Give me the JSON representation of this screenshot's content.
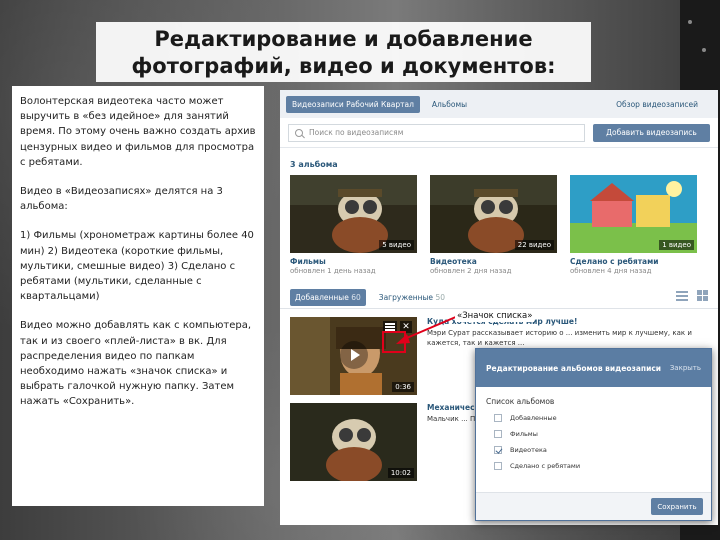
{
  "slide": {
    "title_line1": "Редактирование и добавление",
    "title_line2": "фотографий, видео и документов:",
    "paragraphs": [
      "Волонтерская видеотека часто может выручить в «без идейное» для занятий время. По этому очень важно создать архив цензурных видео и фильмов для просмотра с ребятами.",
      "Видео в «Видеозаписях» делятся на 3 альбома:",
      "1) Фильмы (хронометраж картины более 40 мин) 2) Видеотека (короткие фильмы, мультики, смешные видео) 3) Сделано с ребятами (мультики, сделанные с квартальцами)",
      "Видео можно добавлять как с компьютера, так и из своего «плей-листа» в вк. Для распределения видео по папкам необходимо нажать «значок списка» и выбрать галочкой нужную папку. Затем нажать «Сохранить»."
    ],
    "callout_label": "«Значок списка»"
  },
  "vk": {
    "tabs": [
      {
        "label": "Видеозаписи Рабочий Квартал"
      },
      {
        "label": "Альбомы"
      },
      {
        "label": "Обзор видеозаписей"
      }
    ],
    "search_placeholder": "Поиск по видеозаписям",
    "add_button": "Добавить видеозапись",
    "albums_heading": "3 альбома",
    "albums": [
      {
        "name": "Фильмы",
        "date": "обновлен 1 день назад",
        "count": "5 видео"
      },
      {
        "name": "Видеотека",
        "date": "обновлен 2 дня назад",
        "count": "22 видео"
      },
      {
        "name": "Сделано с ребятами",
        "date": "обновлен 4 дня назад",
        "count": "1 видео"
      }
    ],
    "video_tabs": [
      {
        "label": "Добавленные",
        "count": "60"
      },
      {
        "label": "Загруженные",
        "count": "50"
      }
    ],
    "videos": [
      {
        "title": "Куда хочется сделать мир лучше!",
        "desc": "Мэри Сурат рассказывает историю о ... изменить мир к лучшему, как и кажется, так и кажется ...",
        "duration": "0:36"
      },
      {
        "title": "Механическое сердце",
        "desc": "Мальчик ... Премьера ...",
        "duration": "10:02"
      }
    ]
  },
  "dialog": {
    "title": "Редактирование альбомов видеозаписи",
    "close_label": "Закрыть",
    "subtitle": "Список альбомов",
    "options": [
      {
        "label": "Добавленные",
        "checked": false
      },
      {
        "label": "Фильмы",
        "checked": false
      },
      {
        "label": "Видеотека",
        "checked": true
      },
      {
        "label": "Сделано с ребятами",
        "checked": false
      }
    ],
    "save_button": "Сохранить"
  },
  "colors": {
    "vk_blue": "#5f7fa3",
    "link": "#2b587a",
    "callout_arrow": "#e0001a"
  }
}
